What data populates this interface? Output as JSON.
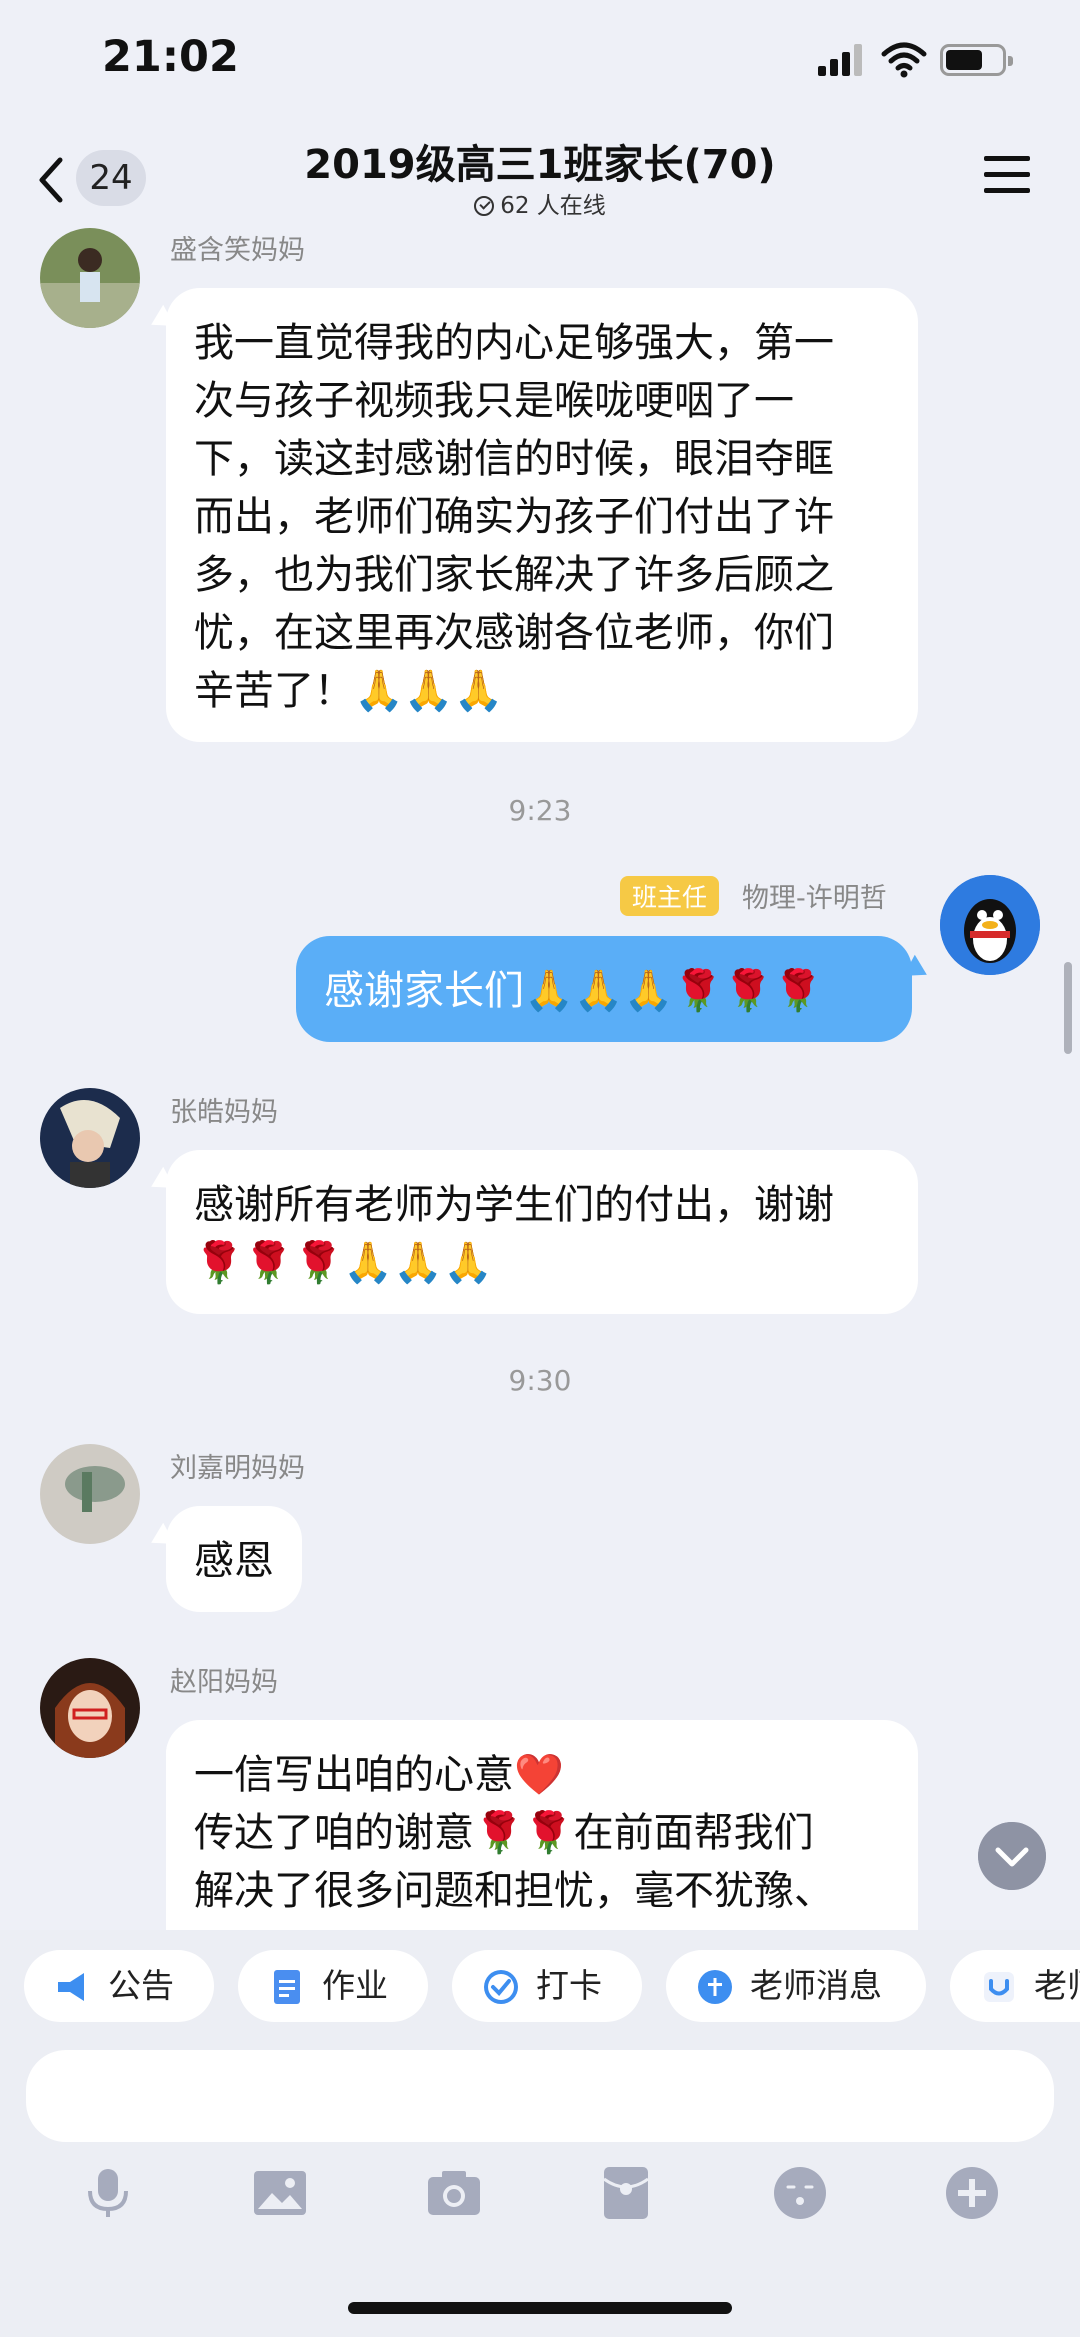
{
  "status": {
    "time": "21:02"
  },
  "header": {
    "back_count": "24",
    "title": "2019级高三1班家长(70)",
    "online": "62 人在线"
  },
  "messages": [
    {
      "sender": "盛含笑妈妈",
      "lines": [
        "我一直觉得我的内心足够强大，第一",
        "次与孩子视频我只是喉咙哽咽了一",
        "下，读这封感谢信的时候，眼泪夺眶",
        "而出，老师们确实为孩子们付出了许",
        "多，也为我们家长解决了许多后顾之",
        "忧，在这里再次感谢各位老师，你们",
        "辛苦了！🙏🙏🙏"
      ]
    },
    {
      "timestamp": "9:23"
    },
    {
      "role_badge": "班主任",
      "sender": "物理-许明哲",
      "lines": [
        "感谢家长们🙏🙏🙏🌹🌹🌹"
      ]
    },
    {
      "sender": "张皓妈妈",
      "lines": [
        "感谢所有老师为学生们的付出，谢谢",
        "🌹🌹🌹🙏🙏🙏"
      ]
    },
    {
      "timestamp": "9:30"
    },
    {
      "sender": "刘嘉明妈妈",
      "lines": [
        "感恩"
      ]
    },
    {
      "sender": "赵阳妈妈",
      "lines": [
        "一信写出咱的心意❤️",
        "传达了咱的谢意🌹🌹在前面帮我们",
        "解决了很多问题和担忧，毫不犹豫、"
      ]
    }
  ],
  "quick_actions": [
    {
      "label": "公告",
      "icon": "megaphone-icon"
    },
    {
      "label": "作业",
      "icon": "document-icon"
    },
    {
      "label": "打卡",
      "icon": "check-icon"
    },
    {
      "label": "老师消息",
      "icon": "teacher-icon"
    },
    {
      "label": "老师",
      "icon": "teacher-badge-icon"
    }
  ],
  "toolbar": [
    "microphone-icon",
    "image-icon",
    "camera-icon",
    "red-packet-icon",
    "emoji-icon",
    "plus-icon"
  ],
  "colors": {
    "accent": "#5aaef7",
    "role_badge": "#f6c945",
    "background": "#eef0f7"
  }
}
